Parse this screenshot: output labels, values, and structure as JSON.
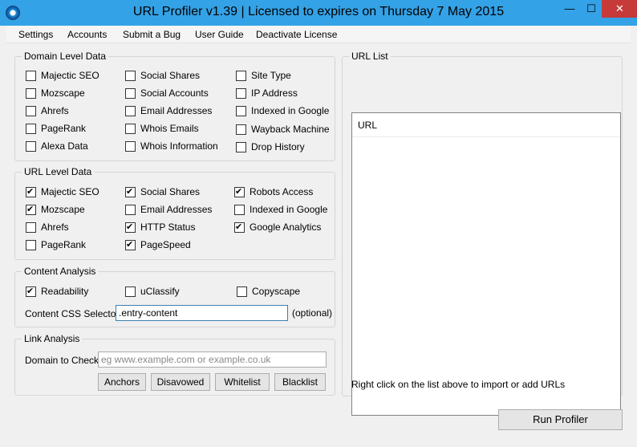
{
  "window": {
    "title": "URL Profiler v1.39 | Licensed to  expires on Thursday 7 May 2015",
    "minimize_glyph": "—",
    "maximize_glyph": "☐",
    "close_glyph": "✕"
  },
  "menu": {
    "settings": "Settings",
    "accounts": "Accounts",
    "submit_bug": "Submit a Bug",
    "user_guide": "User Guide",
    "deactivate": "Deactivate License"
  },
  "domain_level": {
    "title": "Domain Level Data",
    "options": [
      {
        "label": "Majectic SEO",
        "checked": false
      },
      {
        "label": "Mozscape",
        "checked": false
      },
      {
        "label": "Ahrefs",
        "checked": false
      },
      {
        "label": "PageRank",
        "checked": false
      },
      {
        "label": "Alexa Data",
        "checked": false
      },
      {
        "label": "Social Shares",
        "checked": false
      },
      {
        "label": "Social Accounts",
        "checked": false
      },
      {
        "label": "Email Addresses",
        "checked": false
      },
      {
        "label": "Whois Emails",
        "checked": false
      },
      {
        "label": "Whois Information",
        "checked": false
      },
      {
        "label": "Site Type",
        "checked": false
      },
      {
        "label": "IP Address",
        "checked": false
      },
      {
        "label": "Indexed in Google",
        "checked": false
      },
      {
        "label": "Wayback Machine",
        "checked": false
      },
      {
        "label": "Drop History",
        "checked": false
      }
    ]
  },
  "url_level": {
    "title": "URL Level Data",
    "options": [
      {
        "label": "Majectic SEO",
        "checked": true
      },
      {
        "label": "Mozscape",
        "checked": true
      },
      {
        "label": "Ahrefs",
        "checked": false
      },
      {
        "label": "PageRank",
        "checked": false
      },
      {
        "label": "Social Shares",
        "checked": true
      },
      {
        "label": "Email Addresses",
        "checked": false
      },
      {
        "label": "HTTP Status",
        "checked": true
      },
      {
        "label": "PageSpeed",
        "checked": true
      },
      {
        "label": "Robots Access",
        "checked": true
      },
      {
        "label": "Indexed in Google",
        "checked": false
      },
      {
        "label": "Google Analytics",
        "checked": true
      }
    ]
  },
  "content_analysis": {
    "title": "Content Analysis",
    "options": [
      {
        "label": "Readability",
        "checked": true
      },
      {
        "label": "uClassify",
        "checked": false
      },
      {
        "label": "Copyscape",
        "checked": false
      }
    ],
    "selector_label": "Content CSS Selector:",
    "selector_value": ".entry-content",
    "optional_label": "(optional)"
  },
  "link_analysis": {
    "title": "Link Analysis",
    "domain_label": "Domain to Check:",
    "domain_placeholder": "eg www.example.com or example.co.uk",
    "buttons": {
      "anchors": "Anchors",
      "disavowed": "Disavowed",
      "whitelist": "Whitelist",
      "blacklist": "Blacklist"
    }
  },
  "url_list": {
    "title": "URL List",
    "column_header": "URL",
    "hint": "Right click on the list above to import or add URLs"
  },
  "run_button": "Run Profiler"
}
